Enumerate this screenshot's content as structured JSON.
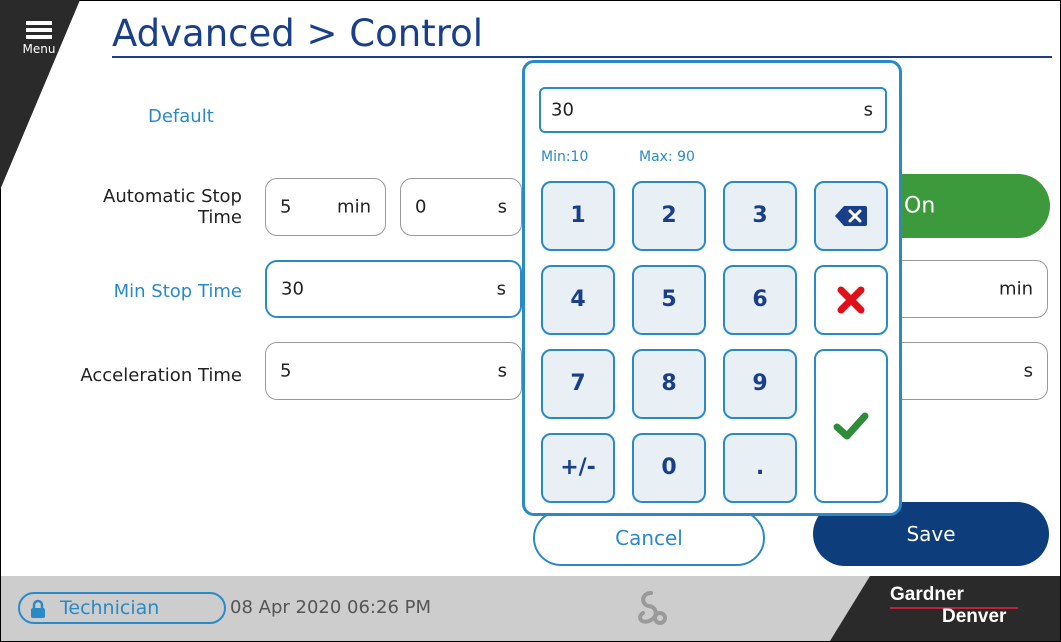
{
  "header": {
    "menu_label": "Menu",
    "title": "Advanced > Control"
  },
  "labels": {
    "default": "Default",
    "automatic_stop_time_1": "Automatic Stop",
    "automatic_stop_time_2": "Time",
    "min_stop_time": "Min Stop Time",
    "acceleration_time": "Acceleration Time"
  },
  "fields": {
    "auto_stop_min": {
      "value": "5",
      "unit": "min"
    },
    "auto_stop_s": {
      "value": "0",
      "unit": "s"
    },
    "min_stop_time": {
      "value": "30",
      "unit": "s"
    },
    "acceleration_time": {
      "value": "5",
      "unit": "s"
    },
    "right_min_unit": "min",
    "right_s_unit": "s"
  },
  "toggle": {
    "label": "On"
  },
  "keypad": {
    "value": "30",
    "unit": "s",
    "min_label": "Min:10",
    "max_label": "Max:  90",
    "keys": [
      "1",
      "2",
      "3",
      "4",
      "5",
      "6",
      "7",
      "8",
      "9",
      "+/-",
      "0",
      "."
    ]
  },
  "buttons": {
    "cancel": "Cancel",
    "save": "Save"
  },
  "status": {
    "role": "Technician",
    "datetime": "08 Apr 2020  06:26 PM",
    "brand_line1": "Gardner",
    "brand_line2": "Denver"
  },
  "colors": {
    "accent": "#2a8ac8",
    "title": "#1a3f8a",
    "save": "#0d3d7a",
    "toggle_on": "#3c9a3c",
    "cancel_x": "#e0101a",
    "ok_check": "#2e8b3a"
  }
}
